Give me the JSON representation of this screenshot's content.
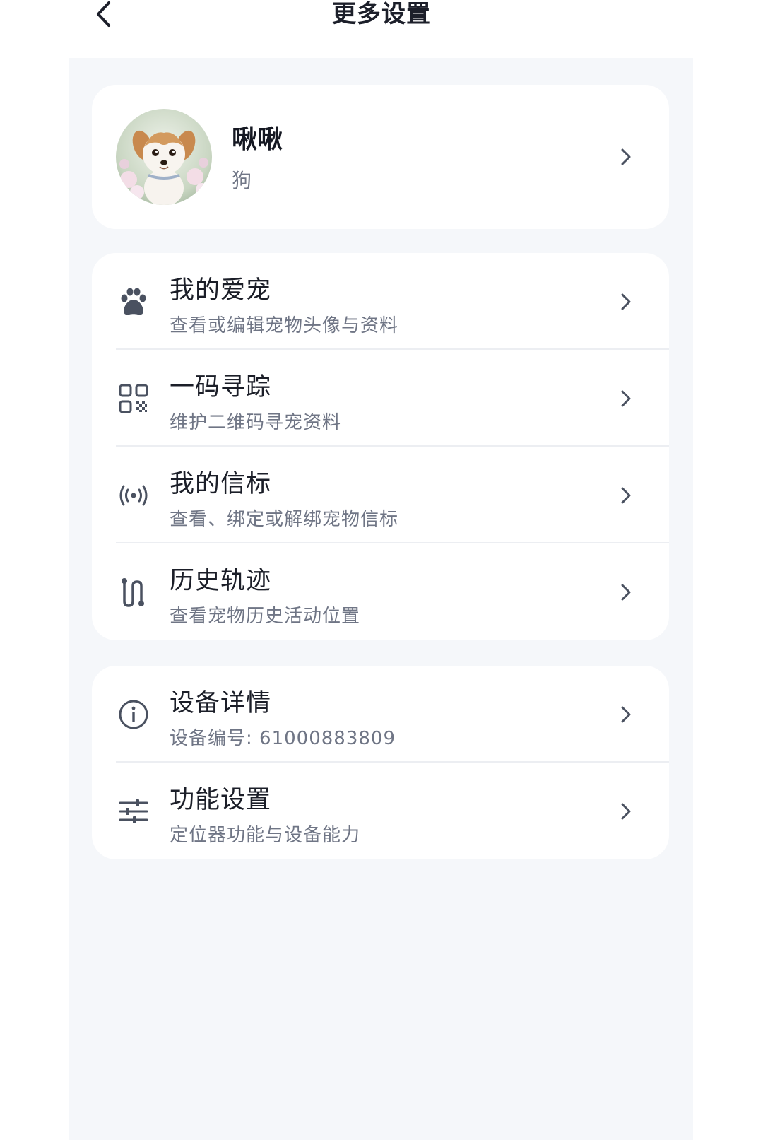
{
  "header": {
    "title": "更多设置",
    "back_icon": "chevron-left-icon"
  },
  "profile": {
    "name": "啾啾",
    "type": "狗"
  },
  "pet_menu": [
    {
      "icon": "paw-icon",
      "title": "我的爱宠",
      "subtitle": "查看或编辑宠物头像与资料"
    },
    {
      "icon": "qr-code-icon",
      "title": "一码寻踪",
      "subtitle": "维护二维码寻宠资料"
    },
    {
      "icon": "beacon-icon",
      "title": "我的信标",
      "subtitle": "查看、绑定或解绑宠物信标"
    },
    {
      "icon": "route-icon",
      "title": "历史轨迹",
      "subtitle": "查看宠物历史活动位置"
    }
  ],
  "device_menu": [
    {
      "icon": "info-icon",
      "title": "设备详情",
      "subtitle": "设备编号: 61000883809"
    },
    {
      "icon": "sliders-icon",
      "title": "功能设置",
      "subtitle": "定位器功能与设备能力"
    }
  ],
  "colors": {
    "background": "#f5f7fa",
    "card": "#ffffff",
    "icon": "#4a5160",
    "title_text": "#1b1e28",
    "subtitle_text": "#6f7585"
  }
}
